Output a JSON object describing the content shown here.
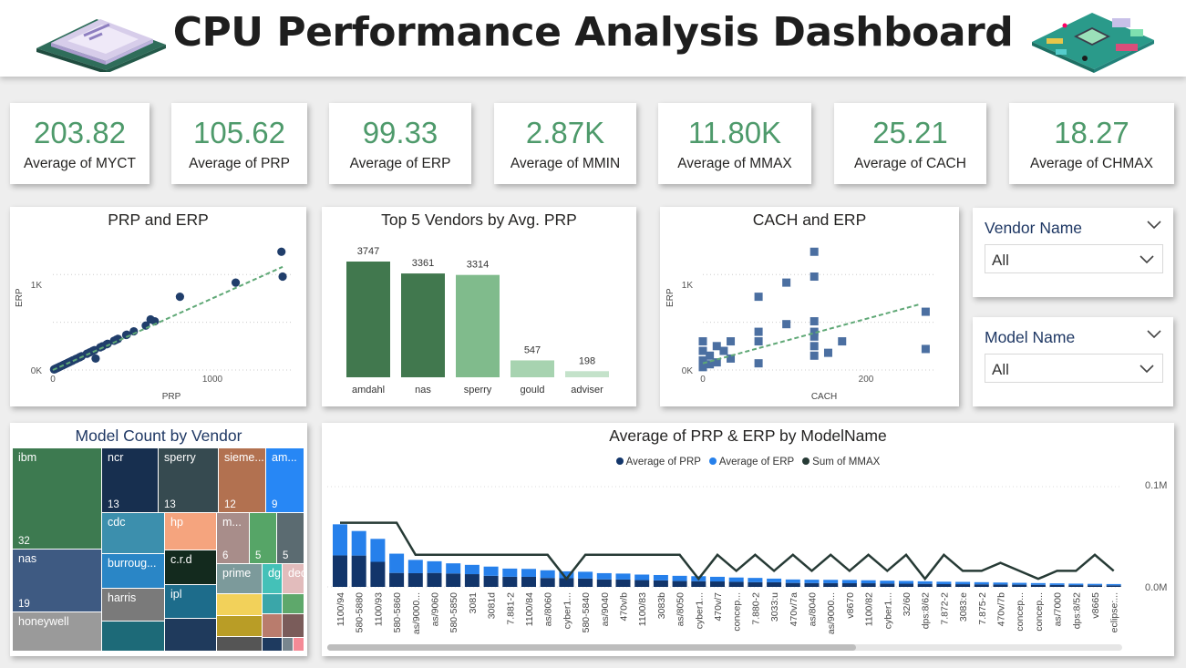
{
  "header": {
    "title": "CPU Performance Analysis Dashboard",
    "left_icon": "cpu-chip-icon",
    "right_icon": "motherboard-icon"
  },
  "kpis": [
    {
      "value": "203.82",
      "label": "Average of MYCT"
    },
    {
      "value": "105.62",
      "label": "Average of PRP"
    },
    {
      "value": "99.33",
      "label": "Average of ERP"
    },
    {
      "value": "2.87K",
      "label": "Average of MMIN"
    },
    {
      "value": "11.80K",
      "label": "Average of MMAX"
    },
    {
      "value": "25.21",
      "label": "Average of CACH"
    },
    {
      "value": "18.27",
      "label": "Average of CHMAX"
    }
  ],
  "colors": {
    "accent_green": "#4e9a6b",
    "dark_green": "#41784e",
    "mid_green": "#80bb8c",
    "light_green": "#a7d3b0",
    "pale_green": "#c4e2ca",
    "navy": "#1f3864",
    "scatter_blue": "#203e6b",
    "square_blue": "#4b6fa1",
    "prp_dark": "#12356a",
    "erp_blue": "#2680eb",
    "mmax_line": "#263a35"
  },
  "scatter_prp_erp": {
    "title": "PRP and ERP",
    "xlabel": "PRP",
    "ylabel": "ERP",
    "xticks": [
      "0",
      "1000"
    ],
    "yticks": [
      "0K",
      "1K"
    ]
  },
  "top_vendors": {
    "title": "Top 5 Vendors by Avg. PRP"
  },
  "scatter_cach_erp": {
    "title": "CACH and ERP",
    "xlabel": "CACH",
    "ylabel": "ERP",
    "xticks": [
      "0",
      "200"
    ],
    "yticks": [
      "0K",
      "1K"
    ]
  },
  "slicers": [
    {
      "title": "Vendor Name",
      "value": "All"
    },
    {
      "title": "Model Name",
      "value": "All"
    }
  ],
  "treemap": {
    "title": "Model Count by Vendor",
    "tiles": [
      {
        "name": "ibm",
        "count": "32",
        "color": "#3d7a50"
      },
      {
        "name": "nas",
        "count": "19",
        "color": "#3e5a82"
      },
      {
        "name": "honeywell",
        "count": "",
        "color": "#9a9a9a"
      },
      {
        "name": "ncr",
        "count": "13",
        "color": "#172f4f"
      },
      {
        "name": "sperry",
        "count": "13",
        "color": "#364a50"
      },
      {
        "name": "sieme...",
        "count": "12",
        "color": "#b27150"
      },
      {
        "name": "am...",
        "count": "9",
        "color": "#2787f5"
      },
      {
        "name": "cdc",
        "count": "",
        "color": "#3c8fad"
      },
      {
        "name": "hp",
        "count": "",
        "color": "#f5a47e"
      },
      {
        "name": "m...",
        "count": "6",
        "color": "#a88d8a"
      },
      {
        "name": "",
        "count": "5",
        "color": "#56a567"
      },
      {
        "name": "",
        "count": "5",
        "color": "#5b6b71"
      },
      {
        "name": "burroug...",
        "count": "",
        "color": "#2a86c6"
      },
      {
        "name": "c.r.d",
        "count": "",
        "color": "#132a1e"
      },
      {
        "name": "prime",
        "count": "",
        "color": "#7c9a9b"
      },
      {
        "name": "dg",
        "count": "",
        "color": "#44c1b8"
      },
      {
        "name": "dec",
        "count": "",
        "color": "#e2bcbc"
      },
      {
        "name": "harris",
        "count": "",
        "color": "#7a7a7a"
      },
      {
        "name": "ipl",
        "count": "",
        "color": "#1d6c8b"
      },
      {
        "name": "",
        "count": "",
        "color": "#f2d15a"
      },
      {
        "name": "",
        "count": "",
        "color": "#b99d26"
      },
      {
        "name": "",
        "count": "",
        "color": "#555"
      },
      {
        "name": "",
        "count": "",
        "color": "#3aa6a9"
      },
      {
        "name": "",
        "count": "",
        "color": "#5ea86b"
      },
      {
        "name": "",
        "count": "",
        "color": "#b97c6d"
      },
      {
        "name": "",
        "count": "",
        "color": "#7a5c5a"
      },
      {
        "name": "",
        "count": "",
        "color": "#1e3a5f"
      },
      {
        "name": "",
        "count": "",
        "color": "#78868e"
      },
      {
        "name": "",
        "count": "",
        "color": "#f58a96"
      },
      {
        "name": "",
        "count": "",
        "color": "#1d6a78"
      },
      {
        "name": "",
        "count": "",
        "color": "#1f3a5c"
      },
      {
        "name": "",
        "count": "",
        "color": "#4aa8b9"
      }
    ]
  },
  "combo": {
    "title": "Average of PRP & ERP by ModelName",
    "legend": [
      "Average of PRP",
      "Average of ERP",
      "Sum of MMAX"
    ],
    "yticks": [
      "0.1M",
      "0.0M"
    ]
  },
  "chart_data": [
    {
      "type": "scatter",
      "title": "PRP and ERP",
      "xlabel": "PRP",
      "ylabel": "ERP",
      "xlim": [
        0,
        1200
      ],
      "ylim": [
        0,
        1250
      ],
      "trendline": [
        [
          0,
          0
        ],
        [
          1150,
          1080
        ]
      ],
      "x": [
        1144,
        1150,
        915,
        636,
        510,
        489,
        465,
        405,
        370,
        367,
        326,
        317,
        306,
        274,
        269,
        248,
        237,
        214,
        208,
        199,
        185,
        172,
        170,
        144,
        138,
        136,
        133,
        132,
        120,
        116,
        111,
        100,
        98,
        93,
        86,
        80,
        74,
        70,
        64,
        60,
        55,
        52,
        46,
        40,
        36,
        32,
        28,
        24,
        20,
        17,
        14,
        12,
        10,
        8,
        6
      ],
      "y": [
        1238,
        978,
        915,
        767,
        510,
        530,
        465,
        405,
        370,
        367,
        326,
        317,
        306,
        274,
        269,
        248,
        237,
        120,
        208,
        199,
        185,
        172,
        170,
        144,
        138,
        136,
        133,
        132,
        120,
        116,
        111,
        100,
        98,
        93,
        86,
        80,
        74,
        70,
        64,
        60,
        55,
        52,
        46,
        40,
        36,
        32,
        28,
        24,
        20,
        17,
        14,
        12,
        10,
        8,
        6
      ]
    },
    {
      "type": "bar",
      "title": "Top 5 Vendors by Avg. PRP",
      "categories": [
        "amdahl",
        "nas",
        "sperry",
        "gould",
        "adviser"
      ],
      "values": [
        3747,
        3361,
        3314,
        547,
        198
      ]
    },
    {
      "type": "scatter",
      "title": "CACH and ERP",
      "xlabel": "CACH",
      "ylabel": "ERP",
      "xlim": [
        0,
        265
      ],
      "ylim": [
        0,
        1250
      ],
      "trendline": [
        [
          0,
          70
        ],
        [
          250,
          690
        ]
      ],
      "x": [
        128,
        128,
        96,
        64,
        128,
        0,
        0,
        0,
        8,
        16,
        24,
        32,
        64,
        64,
        96,
        128,
        128,
        128,
        128,
        160,
        256,
        256,
        144,
        32,
        16,
        8,
        0,
        64
      ],
      "y": [
        1238,
        978,
        915,
        767,
        510,
        300,
        200,
        100,
        150,
        250,
        200,
        300,
        400,
        300,
        480,
        400,
        350,
        250,
        150,
        300,
        610,
        220,
        180,
        120,
        80,
        60,
        30,
        70
      ]
    },
    {
      "type": "bar",
      "title": "Average of PRP & ERP by ModelName",
      "categories": [
        "1100/94",
        "580-5880",
        "1100/93",
        "580-5860",
        "as/9000...",
        "as/9060",
        "580-5850",
        "3081",
        "3081d",
        "7.881-2",
        "1100/84",
        "as/8060",
        "cyber1...",
        "580-5840",
        "as/9040",
        "470v/b",
        "1100/83",
        "3083b",
        "as/8050",
        "cyber1...",
        "470v/7",
        "concep...",
        "7.880-2",
        "3033:u",
        "470v/7a",
        "as/8040",
        "as/9000...",
        "v8670",
        "1100/82",
        "cyber1...",
        "32/60",
        "dps:8/62",
        "7.872-2",
        "3083:e",
        "7.875-2",
        "470v/7b",
        "concep...",
        "concep...",
        "as/7000",
        "dps:8/52",
        "v8665",
        "eclipse:..."
      ],
      "series": [
        {
          "name": "Average of PRP",
          "values": [
            1150,
            1144,
            915,
            510,
            500,
            510,
            489,
            465,
            405,
            370,
            367,
            326,
            317,
            306,
            274,
            269,
            248,
            237,
            214,
            208,
            199,
            185,
            172,
            170,
            144,
            138,
            136,
            133,
            132,
            120,
            116,
            111,
            100,
            98,
            93,
            86,
            80,
            74,
            70,
            64,
            60,
            55
          ]
        },
        {
          "name": "Average of ERP",
          "values": [
            1238,
            978,
            915,
            767,
            530,
            465,
            405,
            370,
            367,
            326,
            317,
            306,
            274,
            269,
            248,
            237,
            220,
            214,
            208,
            199,
            185,
            172,
            170,
            144,
            138,
            136,
            133,
            132,
            120,
            116,
            111,
            100,
            98,
            93,
            86,
            80,
            74,
            70,
            64,
            60,
            55,
            52
          ]
        },
        {
          "name": "Sum of MMAX",
          "values": [
            64000,
            64000,
            64000,
            64000,
            32000,
            32000,
            32000,
            32000,
            32000,
            32000,
            32000,
            32000,
            8000,
            32000,
            32000,
            32000,
            32000,
            32000,
            32000,
            8000,
            32000,
            16000,
            32000,
            16000,
            32000,
            16000,
            32000,
            16000,
            32000,
            16000,
            32000,
            8000,
            32000,
            16000,
            16000,
            24000,
            16000,
            8000,
            16000,
            16000,
            32000,
            16000
          ]
        }
      ]
    }
  ]
}
